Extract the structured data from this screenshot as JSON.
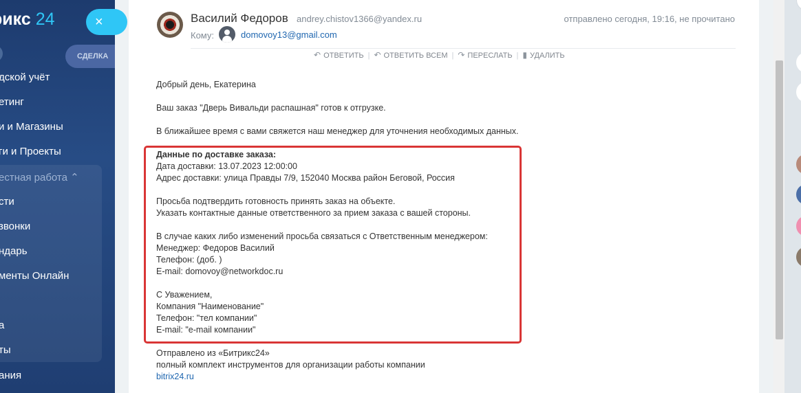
{
  "sidebar": {
    "logo_text": "рикс",
    "logo_num": "24",
    "close_icon": "×",
    "deal_label": "СДЕЛКА",
    "items": [
      {
        "label": "дской учёт"
      },
      {
        "label": "етинг"
      },
      {
        "label": "и и Магазины"
      },
      {
        "label": "ги и Проекты"
      },
      {
        "label": "естная работа ⌃"
      },
      {
        "label": "сти"
      },
      {
        "label": "звонки"
      },
      {
        "label": "ндарь"
      },
      {
        "label": "менты Онлайн"
      },
      {
        "label": "а"
      },
      {
        "label": "ты"
      },
      {
        "label": "ания"
      }
    ]
  },
  "email": {
    "sender_name": "Василий Федоров",
    "sender_email": "andrey.chistov1366@yandex.ru",
    "sent_info": "отправлено сегодня, 19:16, не прочитано",
    "to_label": "Кому:",
    "to_email": "domovoy13@gmail.com",
    "actions": {
      "reply": "ОТВЕТИТЬ",
      "reply_all": "ОТВЕТИТЬ ВСЕМ",
      "forward": "ПЕРЕСЛАТЬ",
      "delete": "УДАЛИТЬ"
    },
    "greeting": "Добрый день, Екатерина",
    "line1": "Ваш заказ \"Дверь Вивальди распашная\" готов к отгрузке.",
    "line2": "В ближайшее время с вами свяжется наш менеджер для уточнения необходимых данных.",
    "box": {
      "heading": "Данные по доставке заказа:",
      "date": "Дата доставки: 13.07.2023 12:00:00",
      "address": "Адрес доставки: улица Правды 7/9, 152040 Москва район Беговой, Россия",
      "confirm1": "Просьба подтвердить готовность принять заказ на объекте.",
      "confirm2": "Указать контактные данные ответственного за прием заказа с вашей стороны.",
      "changes": "В случае каких либо изменений просьба связаться с Ответственным менеджером:",
      "manager": "Менеджер: Федоров Василий",
      "phone": "Телефон:  (доб. )",
      "email": "E-mail: domovoy@networkdoc.ru",
      "regards": "С Уважением,",
      "company": "Компания \"Наименование\"",
      "company_phone": "Телефон: \"тел компании\"",
      "company_email": "E-mail: \"e-mail компании\""
    },
    "footer1": "Отправлено из «Битрикс24»",
    "footer2": "полный комплект инструментов для организации работы компании",
    "footer_link": "bitrix24.ru"
  }
}
